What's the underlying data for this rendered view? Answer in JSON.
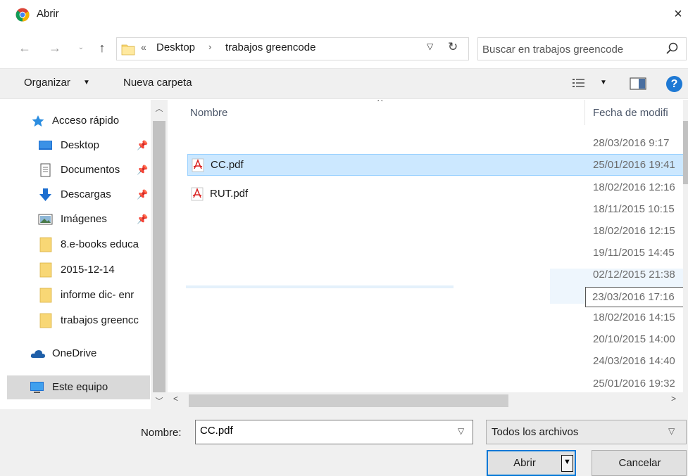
{
  "window": {
    "title": "Abrir",
    "close_glyph": "×"
  },
  "address": {
    "crumbs_prefix": "«",
    "crumbs": [
      "Desktop",
      "trabajos greencode"
    ],
    "separator": "›"
  },
  "search": {
    "placeholder": "Buscar en trabajos greencode"
  },
  "toolbar": {
    "organize_label": "Organizar",
    "new_folder_label": "Nueva carpeta"
  },
  "nav_pane": {
    "items": [
      {
        "label": "Acceso rápido",
        "icon": "star-icon",
        "pinned": false
      },
      {
        "label": "Desktop",
        "icon": "desktop-icon",
        "pinned": true
      },
      {
        "label": "Documentos",
        "icon": "documents-icon",
        "pinned": true
      },
      {
        "label": "Descargas",
        "icon": "download-icon",
        "pinned": true
      },
      {
        "label": "Imágenes",
        "icon": "pictures-icon",
        "pinned": true
      },
      {
        "label": "8.e-books educa",
        "icon": "folder-icon",
        "pinned": false
      },
      {
        "label": "2015-12-14",
        "icon": "folder-icon",
        "pinned": false
      },
      {
        "label": "informe dic- enr",
        "icon": "folder-icon",
        "pinned": false
      },
      {
        "label": "trabajos greencc",
        "icon": "folder-icon",
        "pinned": false
      },
      {
        "label": "OneDrive",
        "icon": "onedrive-icon",
        "pinned": false
      },
      {
        "label": "Este equipo",
        "icon": "computer-icon",
        "pinned": false,
        "selected": true
      }
    ]
  },
  "file_list": {
    "columns": {
      "name": "Nombre",
      "date": "Fecha de modifi"
    },
    "files": [
      {
        "name": "CC.pdf",
        "selected": true
      },
      {
        "name": "RUT.pdf",
        "selected": false
      }
    ],
    "dates": [
      "28/03/2016 9:17",
      "25/01/2016 19:41",
      "18/02/2016 12:16",
      "18/11/2015 10:15",
      "18/02/2016 12:15",
      "19/11/2015 14:45",
      "02/12/2015 21:38",
      "23/03/2016 17:16",
      "18/02/2016 14:15",
      "20/10/2015 14:00",
      "24/03/2016 14:40",
      "25/01/2016 19:32"
    ]
  },
  "bottom": {
    "filename_label": "Nombre:",
    "filename_value": "CC.pdf",
    "filter_value": "Todos los archivos",
    "open_label": "Abrir",
    "cancel_label": "Cancelar"
  },
  "colors": {
    "selection_bg": "#cce8ff",
    "selection_border": "#99d1ff",
    "accent": "#0078d7",
    "help_blue": "#1e79d4"
  }
}
